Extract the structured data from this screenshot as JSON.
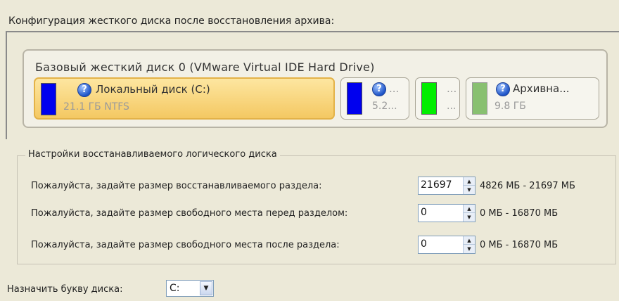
{
  "section_title": "Конфигурация жесткого диска после восстановления архива:",
  "disk": {
    "title": "Базовый жесткий диск 0 (VMware Virtual IDE Hard Drive)",
    "partitions": [
      {
        "name": "Локальный диск (C:)",
        "info": "21.1 ГБ NTFS",
        "color": "#0000ee",
        "selected": true,
        "icon": "help-icon"
      },
      {
        "name": "...",
        "info": "5.2...",
        "color": "#0000ee",
        "selected": false,
        "icon": "help-icon"
      },
      {
        "name": "...",
        "info": "...",
        "color": "#00ee00",
        "selected": false,
        "icon": ""
      },
      {
        "name": "Архивна...",
        "info": "9.8 ГБ",
        "color": "#88c070",
        "selected": false,
        "icon": "help-icon"
      }
    ]
  },
  "settings": {
    "legend": "Настройки восстанавливаемого логического диска",
    "rows": [
      {
        "label": "Пожалуйста, задайте размер восстанавливаемого раздела:",
        "value": "21697",
        "range": "4826 МБ - 21697 МБ"
      },
      {
        "label": "Пожалуйста, задайте размер свободного места перед разделом:",
        "value": "0",
        "range": "0 МБ - 16870 МБ"
      },
      {
        "label": "Пожалуйста, задайте размер свободного места после раздела:",
        "value": "0",
        "range": "0 МБ - 16870 МБ"
      }
    ]
  },
  "drive_letter": {
    "label": "Назначить букву диска:",
    "value": "C:"
  },
  "colors": {
    "selected_partition": "#f4c862",
    "primary_partition": "#0000ee",
    "free_space": "#00ee00",
    "archive_partition": "#88c070"
  }
}
